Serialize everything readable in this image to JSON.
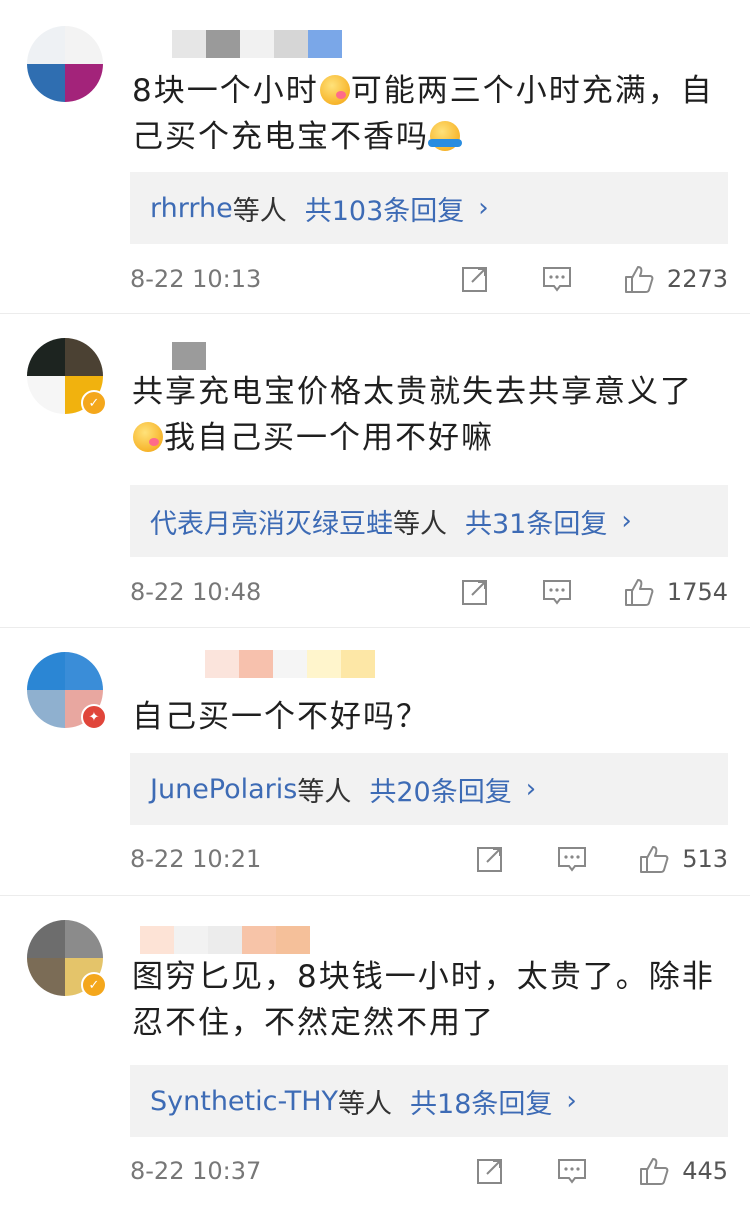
{
  "comments": [
    {
      "text_before": "8块一个小时",
      "text_mid": "可能两三个小时充满，自己买个充电宝不香吗",
      "reply_names": "rhrrhe",
      "reply_suffix": "等人",
      "reply_total": "共103条回复",
      "time": "8-22 10:13",
      "likes": "2273"
    },
    {
      "text_before": "共享充电宝价格太贵就失去共享意义了",
      "text_mid": "我自己买一个用不好嘛",
      "reply_names": "代表月亮消灭绿豆蛙",
      "reply_suffix": "等人",
      "reply_total": "共31条回复",
      "time": "8-22 10:48",
      "likes": "1754"
    },
    {
      "text_before": "自己买一个不好吗？",
      "reply_names": "JunePolaris",
      "reply_suffix": "等人",
      "reply_total": "共20条回复",
      "time": "8-22 10:21",
      "likes": "513"
    },
    {
      "text_before": "图穷匕见，8块钱一小时，太贵了。除非忍不住，不然定然不用了",
      "reply_names": "Synthetic-THY",
      "reply_suffix": "等人",
      "reply_total": "共18条回复",
      "time": "8-22 10:37",
      "likes": "445"
    }
  ],
  "reply_chevron": "›",
  "icons": {
    "share": "share-icon",
    "comment": "comment-icon",
    "like": "thumbs-up-icon"
  },
  "colors": {
    "link": "#3d6bb5",
    "reply_bg": "#f2f2f2",
    "time": "#777777"
  }
}
